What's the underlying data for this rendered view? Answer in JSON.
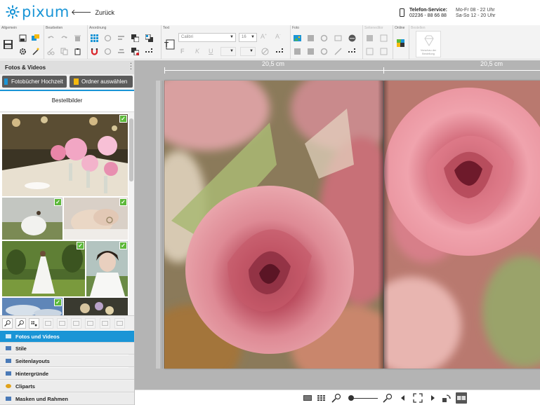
{
  "header": {
    "logo_text": "pixum",
    "back_label": "Zurück",
    "service_title": "Telefon-Service:",
    "service_phone": "02236 - 88 66 88",
    "hours_1": "Mo-Fr 08 - 22 Uhr",
    "hours_2": "Sa-So 12 - 20 Uhr"
  },
  "toolbar": {
    "groups": [
      "Allgemein",
      "Bearbeiten",
      "Anordnung",
      "Text",
      "Foto",
      "Seiteneditor",
      "Online",
      "Bestellen"
    ],
    "font_name": "Calibri",
    "font_size": "16",
    "bestell_badge": "Vorschau der Bestellung"
  },
  "sidebar": {
    "title": "Fotos & Videos",
    "btn_album": "Fotobücher Hochzeit",
    "btn_folder": "Ordner auswählen",
    "bestellbilder": "Bestellbilder",
    "panels": [
      {
        "label": "Fotos und Videos",
        "active": true
      },
      {
        "label": "Stile",
        "active": false
      },
      {
        "label": "Seitenlayouts",
        "active": false
      },
      {
        "label": "Hintergründe",
        "active": false
      },
      {
        "label": "Cliparts",
        "active": false
      },
      {
        "label": "Masken und Rahmen",
        "active": false
      }
    ]
  },
  "canvas": {
    "ruler_left": "20,5 cm",
    "ruler_right": "20,5 cm"
  },
  "colors": {
    "brand": "#1a95d6",
    "check": "#5cb83a",
    "canvas_bg": "#b4b4b4"
  }
}
